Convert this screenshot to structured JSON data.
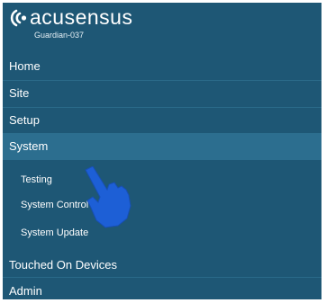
{
  "brand": {
    "logo_text": "acusensus",
    "device_id": "Guardian-037"
  },
  "nav": {
    "home": "Home",
    "site": "Site",
    "setup": "Setup",
    "system": "System",
    "system_sub": {
      "testing": "Testing",
      "system_control": "System Control",
      "system_update": "System Update"
    },
    "touched_on_devices": "Touched On Devices",
    "admin": "Admin"
  },
  "colors": {
    "background": "#1e5775",
    "active_item": "#2c6e8f",
    "pointer_hand": "#1d5fd6"
  },
  "icons": {
    "logo": "acusensus-logo-icon",
    "pointer": "pointing-hand-icon"
  }
}
